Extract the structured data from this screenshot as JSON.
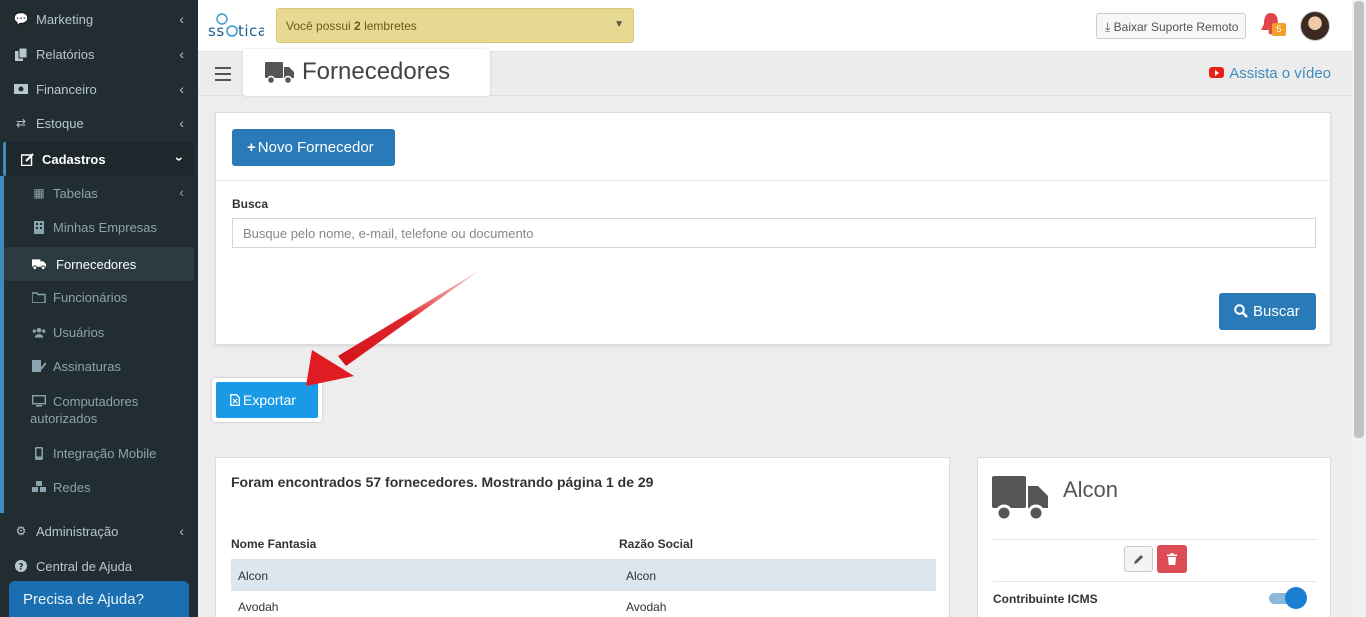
{
  "sidebar": {
    "items": [
      {
        "label": "Marketing",
        "icon": "comments-icon"
      },
      {
        "label": "Relatórios",
        "icon": "copy-icon"
      },
      {
        "label": "Financeiro",
        "icon": "money-icon"
      },
      {
        "label": "Estoque",
        "icon": "exchange-icon"
      },
      {
        "label": "Cadastros",
        "icon": "edit-icon"
      }
    ],
    "submenu": [
      {
        "label": "Tabelas",
        "icon": "table-icon"
      },
      {
        "label": "Minhas Empresas",
        "icon": "building-icon"
      },
      {
        "label": "Fornecedores",
        "icon": "truck-icon"
      },
      {
        "label": "Funcionários",
        "icon": "folder-icon"
      },
      {
        "label": "Usuários",
        "icon": "users-icon"
      },
      {
        "label": "Assinaturas",
        "icon": "signature-icon"
      },
      {
        "label_line1": "Computadores",
        "label_line2": "autorizados",
        "icon": "desktop-icon"
      },
      {
        "label": "Integração Mobile",
        "icon": "mobile-icon"
      },
      {
        "label": "Redes",
        "icon": "cubes-icon"
      }
    ],
    "bottom": [
      {
        "label": "Administração",
        "icon": "cogs-icon"
      },
      {
        "label": "Central de Ajuda",
        "icon": "question-icon"
      }
    ],
    "help_button": "Precisa de Ajuda?"
  },
  "topbar": {
    "logo": "ssOtica",
    "reminder_prefix": "Você possui ",
    "reminder_count": "2",
    "reminder_suffix": " lembretes",
    "download_label": "Baixar Suporte Remoto",
    "notification_count": "5"
  },
  "header": {
    "title": "Fornecedores",
    "video_link": "Assista o vídeo"
  },
  "search": {
    "new_button": "Novo Fornecedor",
    "label": "Busca",
    "placeholder": "Busque pelo nome, e-mail, telefone ou documento",
    "search_button": "Buscar"
  },
  "export_button": "Exportar",
  "results": {
    "summary": "Foram encontrados 57 fornecedores. Mostrando página 1 de 29",
    "columns": [
      "Nome Fantasia",
      "Razão Social"
    ],
    "rows": [
      {
        "fantasia": "Alcon",
        "razao": "Alcon"
      },
      {
        "fantasia": "Avodah",
        "razao": "Avodah"
      }
    ]
  },
  "detail": {
    "name": "Alcon",
    "icms_label": "Contribuinte ICMS",
    "icms_enabled": true
  },
  "colors": {
    "sidebar_bg": "#222d32",
    "primary": "#2a7ab8",
    "export": "#1a9ae6",
    "danger": "#dd4b54",
    "reminder": "#e8d992"
  }
}
